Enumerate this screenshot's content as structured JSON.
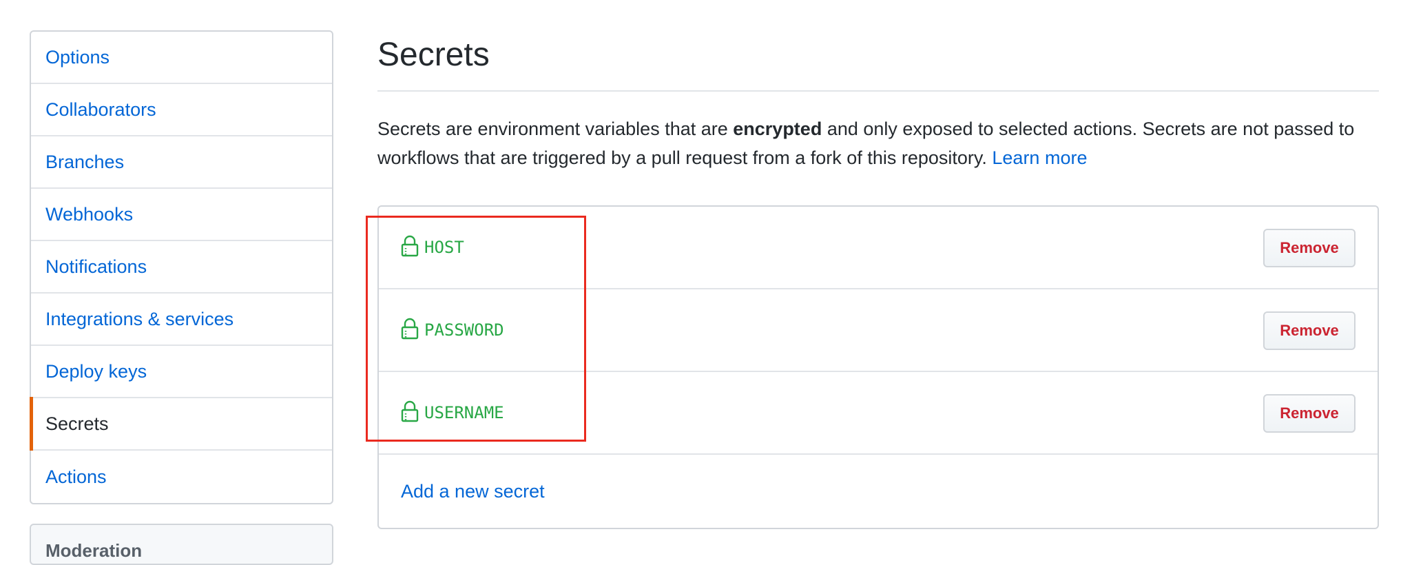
{
  "sidebar": {
    "items": [
      {
        "label": "Options",
        "selected": false
      },
      {
        "label": "Collaborators",
        "selected": false
      },
      {
        "label": "Branches",
        "selected": false
      },
      {
        "label": "Webhooks",
        "selected": false
      },
      {
        "label": "Notifications",
        "selected": false
      },
      {
        "label": "Integrations & services",
        "selected": false
      },
      {
        "label": "Deploy keys",
        "selected": false
      },
      {
        "label": "Secrets",
        "selected": true
      },
      {
        "label": "Actions",
        "selected": false
      }
    ],
    "moderation_heading": "Moderation"
  },
  "main": {
    "title": "Secrets",
    "description": {
      "part1": "Secrets are environment variables that are ",
      "bold": "encrypted",
      "part2": " and only exposed to selected actions. Secrets are not passed to workflows that are triggered by a pull request from a fork of this repository. ",
      "link": "Learn more"
    },
    "secrets": [
      {
        "name": "HOST",
        "icon": "lock-icon",
        "remove_label": "Remove"
      },
      {
        "name": "PASSWORD",
        "icon": "lock-icon",
        "remove_label": "Remove"
      },
      {
        "name": "USERNAME",
        "icon": "lock-icon",
        "remove_label": "Remove"
      }
    ],
    "add_secret_label": "Add a new secret"
  },
  "colors": {
    "link": "#0366d6",
    "secret_name": "#28a745",
    "remove_text": "#cb2431",
    "selected_accent": "#e36209",
    "highlight": "#ea2a1f"
  }
}
